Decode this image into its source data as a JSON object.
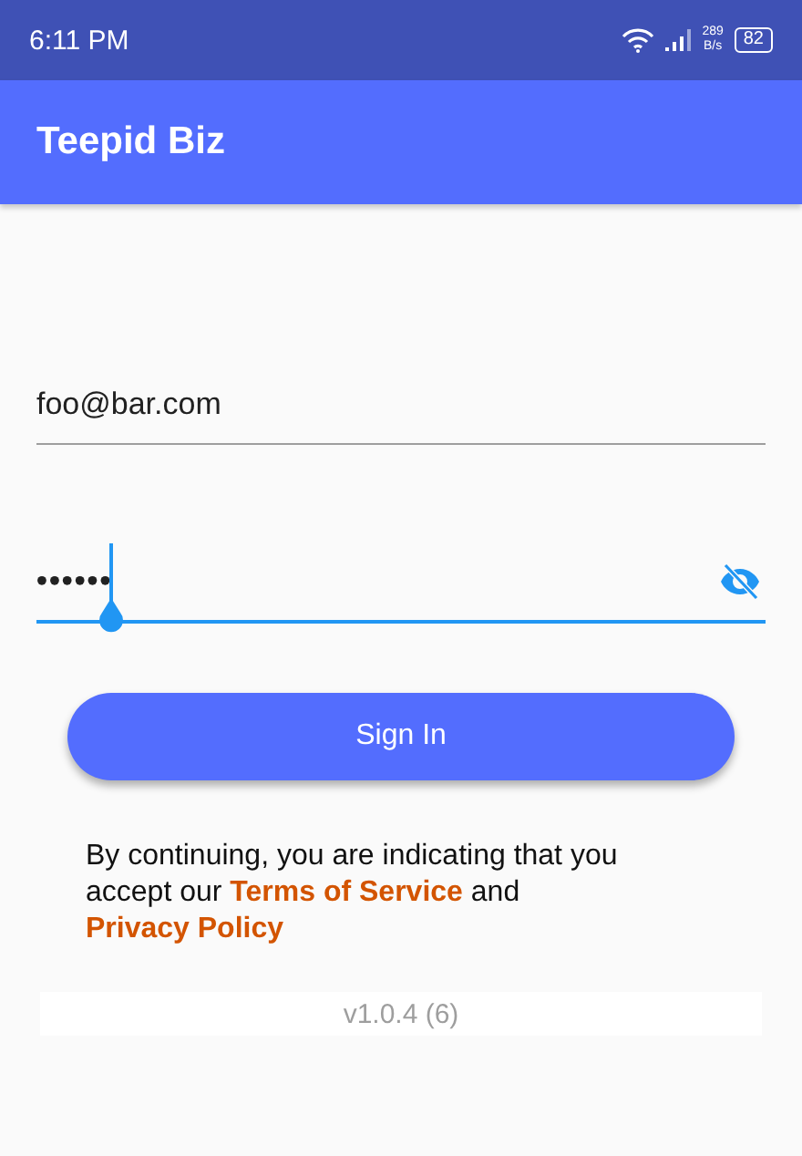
{
  "status_bar": {
    "time": "6:11 PM",
    "speed_value": "289",
    "speed_unit": "B/s",
    "battery": "82"
  },
  "app_bar": {
    "title": "Teepid Biz"
  },
  "fields": [
    {
      "kind": "email",
      "value": "foo@bar.com",
      "focused": false
    },
    {
      "kind": "password",
      "value": "••••••",
      "focused": true,
      "obscured": true
    }
  ],
  "sign_in_button": "Sign In",
  "terms": {
    "before": "By continuing, you are indicating that you accept our",
    "link_terms": "Terms of Service",
    "middle": "and",
    "link_privacy": "Privacy Policy"
  },
  "version": "v1.0.4 (6)"
}
